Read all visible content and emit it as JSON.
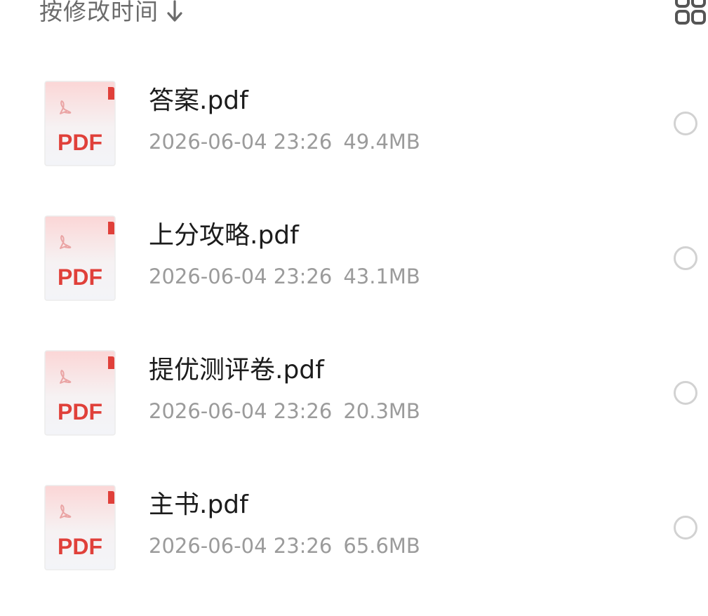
{
  "header": {
    "sort_label": "按修改时间",
    "sort_direction_icon": "arrow-down-icon",
    "view_toggle_icon": "grid-view-icon"
  },
  "files": [
    {
      "name": "答案.pdf",
      "date": "2026-06-04 23:26",
      "size": "49.4MB",
      "thumb_label": "PDF"
    },
    {
      "name": "上分攻略.pdf",
      "date": "2026-06-04 23:26",
      "size": "43.1MB",
      "thumb_label": "PDF"
    },
    {
      "name": "提优测评卷.pdf",
      "date": "2026-06-04 23:26",
      "size": "20.3MB",
      "thumb_label": "PDF"
    },
    {
      "name": "主书.pdf",
      "date": "2026-06-04 23:26",
      "size": "65.6MB",
      "thumb_label": "PDF"
    }
  ],
  "colors": {
    "pdf_red": "#e0403a",
    "text_primary": "#1c1c1c",
    "text_secondary": "#9b9b9b",
    "header_text": "#6b6b6b"
  }
}
